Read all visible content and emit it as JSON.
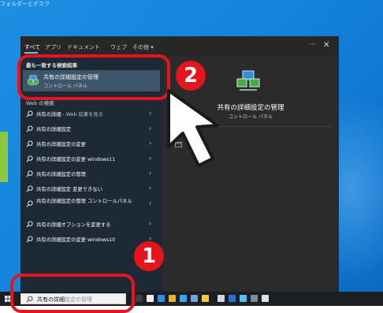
{
  "desktop": {
    "caption": "フォルダーとデスク"
  },
  "scope_bar": {
    "tabs": [
      {
        "label": "すべて"
      },
      {
        "label": "アプリ"
      },
      {
        "label": "ドキュメント"
      },
      {
        "label": "ウェブ"
      },
      {
        "label": "その他"
      }
    ],
    "more_label": "···",
    "close_label": "✕"
  },
  "left": {
    "best_match_heading": "最も一致する検索結果",
    "best_match": {
      "title": "共有の詳細設定の管理",
      "subtitle": "コントロール パネル"
    },
    "web_heading": "Web の検索",
    "web_items": [
      {
        "query": "共有の詳細",
        "suffix": " - Web 結果を見る"
      },
      {
        "query": "共有の詳細設定",
        "suffix": ""
      },
      {
        "query": "共有の詳細設定の変更",
        "suffix": ""
      },
      {
        "query": "共有の詳細設定の変更 windows11",
        "suffix": ""
      },
      {
        "query": "共有の詳細設定の管理",
        "suffix": ""
      },
      {
        "query": "共有の詳細設定 変更できない",
        "suffix": ""
      },
      {
        "query": "共有の詳細設定の管理 コントロールパネル",
        "suffix": ""
      },
      {
        "query": "共有の詳細オプションを変更する",
        "suffix": ""
      },
      {
        "query": "共有の詳細設定の変更 windows10",
        "suffix": ""
      }
    ]
  },
  "preview": {
    "title": "共有の詳細設定の管理",
    "subtitle": "コントロール パネル"
  },
  "taskbar": {
    "search_typed": "共有の詳細",
    "search_suggest": "設定の管理"
  },
  "annotations": {
    "badge_1": "1",
    "badge_2": "2",
    "color": "#e4151d"
  },
  "colors": {
    "desktop": "#1383dc",
    "panel_left": "#1d2a35",
    "panel_right": "#2b2b2b",
    "selected_row": "#3d5568",
    "accent": "#78b9ff"
  }
}
